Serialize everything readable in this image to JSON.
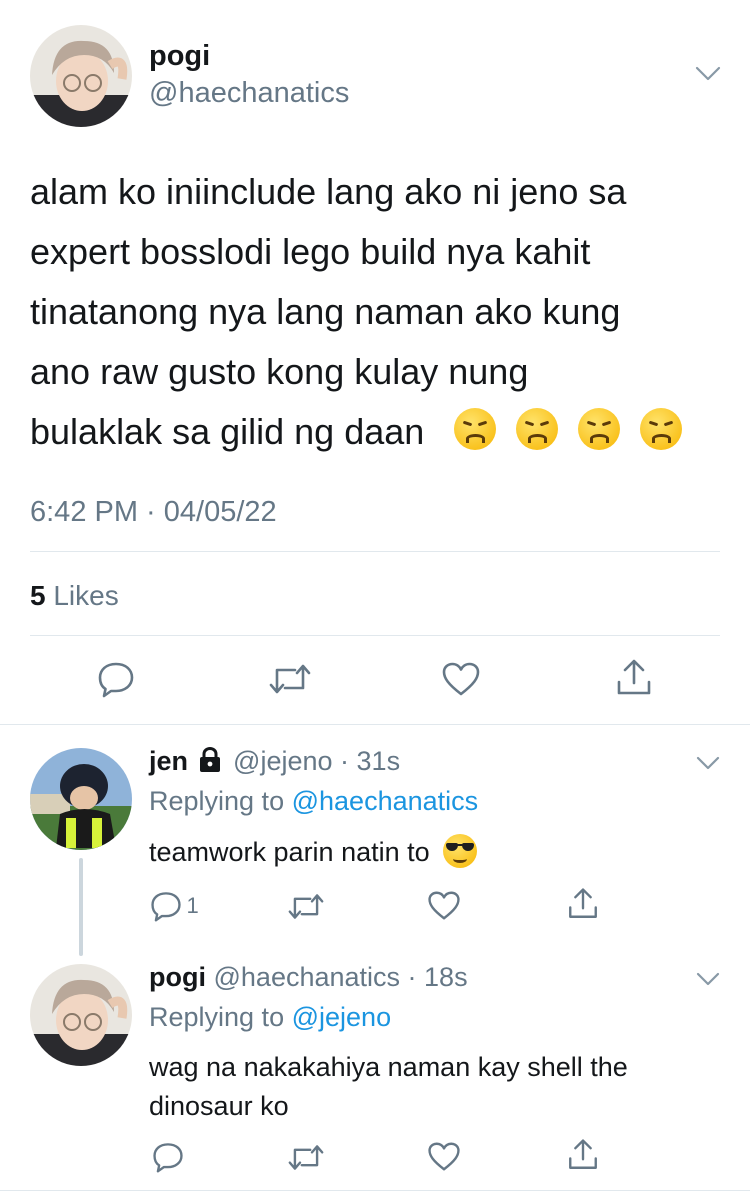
{
  "main_tweet": {
    "display_name": "pogi",
    "handle": "@haechanatics",
    "text_lines": [
      "alam ko iniinclude lang ako ni jeno sa",
      "expert bosslodi lego build nya kahit",
      "tinatanong nya lang naman ako kung",
      "ano raw gusto kong kulay nung",
      "bulaklak sa gilid ng daan"
    ],
    "emoji": [
      "disappointed-face",
      "disappointed-face",
      "disappointed-face",
      "disappointed-face"
    ],
    "timestamp": "6:42 PM · 04/05/22",
    "likes_count": "5",
    "likes_label": "Likes"
  },
  "replies": [
    {
      "display_name": "jen",
      "locked": true,
      "handle": "@jejeno",
      "time": "· 31s",
      "replying_prefix": "Replying to",
      "replying_to": "@haechanatics",
      "text": "teamwork parin natin to",
      "emoji": "smiling-face-with-sunglasses",
      "reply_count": "1"
    },
    {
      "display_name": "pogi",
      "locked": false,
      "handle": "@haechanatics",
      "time": "· 18s",
      "replying_prefix": "Replying to",
      "replying_to": "@jejeno",
      "text_lines": [
        "wag na nakakahiya naman kay shell the",
        "dinosaur ko"
      ],
      "reply_count": ""
    }
  ],
  "colors": {
    "text": "#14171a",
    "muted": "#657786",
    "link": "#1b95e0",
    "divider": "#e1e8ed"
  }
}
